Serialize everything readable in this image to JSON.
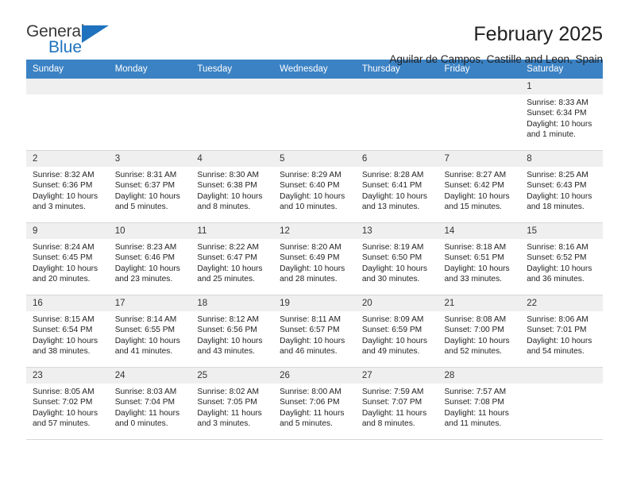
{
  "brand": {
    "name_part1": "General",
    "name_part2": "Blue",
    "accent_color": "#1f72bd"
  },
  "header": {
    "title": "February 2025",
    "location": "Aguilar de Campos, Castille and Leon, Spain"
  },
  "theme": {
    "header_row_bg": "#3b82c4",
    "daynum_bg": "#efefef",
    "grid_line": "#d7d7d7"
  },
  "weekdays": [
    "Sunday",
    "Monday",
    "Tuesday",
    "Wednesday",
    "Thursday",
    "Friday",
    "Saturday"
  ],
  "weeks": [
    [
      {
        "day": "",
        "sunrise": "",
        "sunset": "",
        "daylight": "",
        "daylight2": ""
      },
      {
        "day": "",
        "sunrise": "",
        "sunset": "",
        "daylight": "",
        "daylight2": ""
      },
      {
        "day": "",
        "sunrise": "",
        "sunset": "",
        "daylight": "",
        "daylight2": ""
      },
      {
        "day": "",
        "sunrise": "",
        "sunset": "",
        "daylight": "",
        "daylight2": ""
      },
      {
        "day": "",
        "sunrise": "",
        "sunset": "",
        "daylight": "",
        "daylight2": ""
      },
      {
        "day": "",
        "sunrise": "",
        "sunset": "",
        "daylight": "",
        "daylight2": ""
      },
      {
        "day": "1",
        "sunrise": "Sunrise: 8:33 AM",
        "sunset": "Sunset: 6:34 PM",
        "daylight": "Daylight: 10 hours",
        "daylight2": "and 1 minute."
      }
    ],
    [
      {
        "day": "2",
        "sunrise": "Sunrise: 8:32 AM",
        "sunset": "Sunset: 6:36 PM",
        "daylight": "Daylight: 10 hours",
        "daylight2": "and 3 minutes."
      },
      {
        "day": "3",
        "sunrise": "Sunrise: 8:31 AM",
        "sunset": "Sunset: 6:37 PM",
        "daylight": "Daylight: 10 hours",
        "daylight2": "and 5 minutes."
      },
      {
        "day": "4",
        "sunrise": "Sunrise: 8:30 AM",
        "sunset": "Sunset: 6:38 PM",
        "daylight": "Daylight: 10 hours",
        "daylight2": "and 8 minutes."
      },
      {
        "day": "5",
        "sunrise": "Sunrise: 8:29 AM",
        "sunset": "Sunset: 6:40 PM",
        "daylight": "Daylight: 10 hours",
        "daylight2": "and 10 minutes."
      },
      {
        "day": "6",
        "sunrise": "Sunrise: 8:28 AM",
        "sunset": "Sunset: 6:41 PM",
        "daylight": "Daylight: 10 hours",
        "daylight2": "and 13 minutes."
      },
      {
        "day": "7",
        "sunrise": "Sunrise: 8:27 AM",
        "sunset": "Sunset: 6:42 PM",
        "daylight": "Daylight: 10 hours",
        "daylight2": "and 15 minutes."
      },
      {
        "day": "8",
        "sunrise": "Sunrise: 8:25 AM",
        "sunset": "Sunset: 6:43 PM",
        "daylight": "Daylight: 10 hours",
        "daylight2": "and 18 minutes."
      }
    ],
    [
      {
        "day": "9",
        "sunrise": "Sunrise: 8:24 AM",
        "sunset": "Sunset: 6:45 PM",
        "daylight": "Daylight: 10 hours",
        "daylight2": "and 20 minutes."
      },
      {
        "day": "10",
        "sunrise": "Sunrise: 8:23 AM",
        "sunset": "Sunset: 6:46 PM",
        "daylight": "Daylight: 10 hours",
        "daylight2": "and 23 minutes."
      },
      {
        "day": "11",
        "sunrise": "Sunrise: 8:22 AM",
        "sunset": "Sunset: 6:47 PM",
        "daylight": "Daylight: 10 hours",
        "daylight2": "and 25 minutes."
      },
      {
        "day": "12",
        "sunrise": "Sunrise: 8:20 AM",
        "sunset": "Sunset: 6:49 PM",
        "daylight": "Daylight: 10 hours",
        "daylight2": "and 28 minutes."
      },
      {
        "day": "13",
        "sunrise": "Sunrise: 8:19 AM",
        "sunset": "Sunset: 6:50 PM",
        "daylight": "Daylight: 10 hours",
        "daylight2": "and 30 minutes."
      },
      {
        "day": "14",
        "sunrise": "Sunrise: 8:18 AM",
        "sunset": "Sunset: 6:51 PM",
        "daylight": "Daylight: 10 hours",
        "daylight2": "and 33 minutes."
      },
      {
        "day": "15",
        "sunrise": "Sunrise: 8:16 AM",
        "sunset": "Sunset: 6:52 PM",
        "daylight": "Daylight: 10 hours",
        "daylight2": "and 36 minutes."
      }
    ],
    [
      {
        "day": "16",
        "sunrise": "Sunrise: 8:15 AM",
        "sunset": "Sunset: 6:54 PM",
        "daylight": "Daylight: 10 hours",
        "daylight2": "and 38 minutes."
      },
      {
        "day": "17",
        "sunrise": "Sunrise: 8:14 AM",
        "sunset": "Sunset: 6:55 PM",
        "daylight": "Daylight: 10 hours",
        "daylight2": "and 41 minutes."
      },
      {
        "day": "18",
        "sunrise": "Sunrise: 8:12 AM",
        "sunset": "Sunset: 6:56 PM",
        "daylight": "Daylight: 10 hours",
        "daylight2": "and 43 minutes."
      },
      {
        "day": "19",
        "sunrise": "Sunrise: 8:11 AM",
        "sunset": "Sunset: 6:57 PM",
        "daylight": "Daylight: 10 hours",
        "daylight2": "and 46 minutes."
      },
      {
        "day": "20",
        "sunrise": "Sunrise: 8:09 AM",
        "sunset": "Sunset: 6:59 PM",
        "daylight": "Daylight: 10 hours",
        "daylight2": "and 49 minutes."
      },
      {
        "day": "21",
        "sunrise": "Sunrise: 8:08 AM",
        "sunset": "Sunset: 7:00 PM",
        "daylight": "Daylight: 10 hours",
        "daylight2": "and 52 minutes."
      },
      {
        "day": "22",
        "sunrise": "Sunrise: 8:06 AM",
        "sunset": "Sunset: 7:01 PM",
        "daylight": "Daylight: 10 hours",
        "daylight2": "and 54 minutes."
      }
    ],
    [
      {
        "day": "23",
        "sunrise": "Sunrise: 8:05 AM",
        "sunset": "Sunset: 7:02 PM",
        "daylight": "Daylight: 10 hours",
        "daylight2": "and 57 minutes."
      },
      {
        "day": "24",
        "sunrise": "Sunrise: 8:03 AM",
        "sunset": "Sunset: 7:04 PM",
        "daylight": "Daylight: 11 hours",
        "daylight2": "and 0 minutes."
      },
      {
        "day": "25",
        "sunrise": "Sunrise: 8:02 AM",
        "sunset": "Sunset: 7:05 PM",
        "daylight": "Daylight: 11 hours",
        "daylight2": "and 3 minutes."
      },
      {
        "day": "26",
        "sunrise": "Sunrise: 8:00 AM",
        "sunset": "Sunset: 7:06 PM",
        "daylight": "Daylight: 11 hours",
        "daylight2": "and 5 minutes."
      },
      {
        "day": "27",
        "sunrise": "Sunrise: 7:59 AM",
        "sunset": "Sunset: 7:07 PM",
        "daylight": "Daylight: 11 hours",
        "daylight2": "and 8 minutes."
      },
      {
        "day": "28",
        "sunrise": "Sunrise: 7:57 AM",
        "sunset": "Sunset: 7:08 PM",
        "daylight": "Daylight: 11 hours",
        "daylight2": "and 11 minutes."
      },
      {
        "day": "",
        "sunrise": "",
        "sunset": "",
        "daylight": "",
        "daylight2": ""
      }
    ]
  ]
}
